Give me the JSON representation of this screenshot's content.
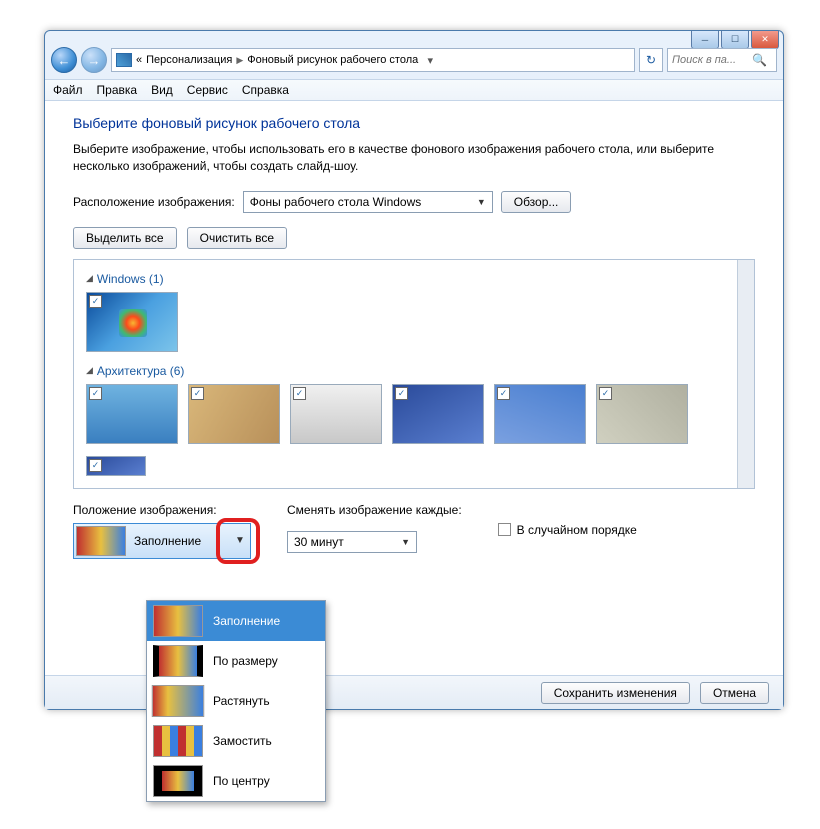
{
  "breadcrumb": {
    "back": "«",
    "root": "Персонализация",
    "current": "Фоновый рисунок рабочего стола"
  },
  "search": {
    "placeholder": "Поиск в па...",
    "icon": "search-icon"
  },
  "menu": {
    "file": "Файл",
    "edit": "Правка",
    "view": "Вид",
    "tools": "Сервис",
    "help": "Справка"
  },
  "page": {
    "title": "Выберите фоновый рисунок рабочего стола",
    "desc": "Выберите изображение, чтобы использовать его в качестве фонового изображения рабочего стола, или выберите несколько изображений, чтобы создать слайд-шоу."
  },
  "location": {
    "label": "Расположение изображения:",
    "value": "Фоны рабочего стола Windows",
    "browse": "Обзор..."
  },
  "buttons": {
    "select_all": "Выделить все",
    "clear_all": "Очистить все"
  },
  "groups": {
    "g1": "Windows (1)",
    "g2": "Архитектура (6)"
  },
  "options": {
    "position_label": "Положение изображения:",
    "position_value": "Заполнение",
    "interval_label": "Сменять изображение каждые:",
    "interval_value": "30 минут",
    "random": "В случайном порядке"
  },
  "dropdown": {
    "fill": "Заполнение",
    "fit": "По размеру",
    "stretch": "Растянуть",
    "tile": "Замостить",
    "center": "По центру"
  },
  "footer": {
    "save": "Сохранить изменения",
    "cancel": "Отмена"
  }
}
